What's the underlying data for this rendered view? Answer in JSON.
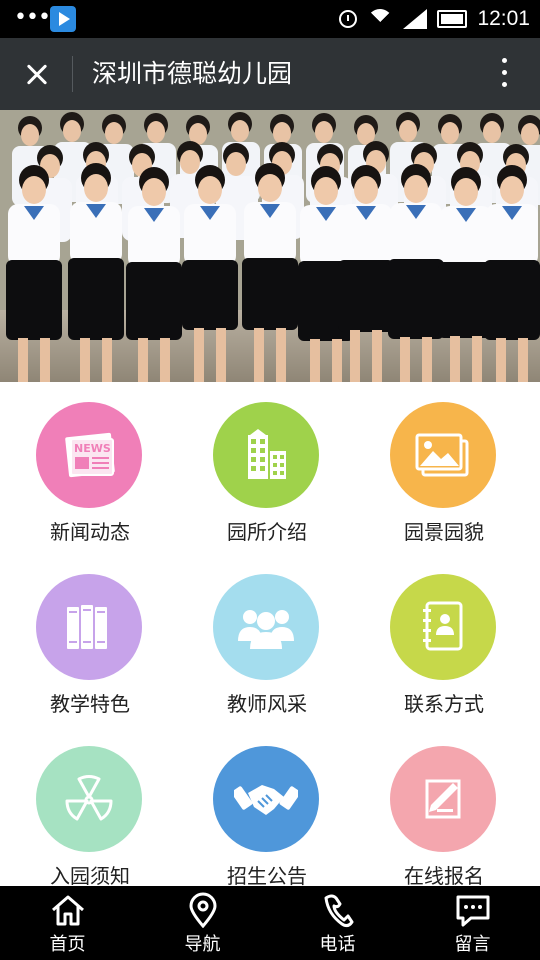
{
  "status_bar": {
    "time": "12:01"
  },
  "title_bar": {
    "title": "深圳市德聪幼儿园"
  },
  "grid": {
    "items": [
      {
        "label": "新闻动态",
        "color": "#f07fb8",
        "icon": "news-icon"
      },
      {
        "label": "园所介绍",
        "color": "#9fd24b",
        "icon": "building-icon"
      },
      {
        "label": "园景园貌",
        "color": "#f7b54b",
        "icon": "gallery-icon"
      },
      {
        "label": "教学特色",
        "color": "#c7a3ea",
        "icon": "books-icon"
      },
      {
        "label": "教师风采",
        "color": "#a4ddee",
        "icon": "people-icon"
      },
      {
        "label": "联系方式",
        "color": "#c6d84a",
        "icon": "contact-book-icon"
      },
      {
        "label": "入园须知",
        "color": "#a6e2c2",
        "icon": "fan-icon"
      },
      {
        "label": "招生公告",
        "color": "#4f97da",
        "icon": "handshake-icon"
      },
      {
        "label": "在线报名",
        "color": "#f4a6ae",
        "icon": "signup-form-icon"
      }
    ]
  },
  "tab_bar": {
    "tabs": [
      {
        "label": "首页",
        "icon": "home-icon"
      },
      {
        "label": "导航",
        "icon": "location-pin-icon"
      },
      {
        "label": "电话",
        "icon": "phone-icon"
      },
      {
        "label": "留言",
        "icon": "message-icon"
      }
    ]
  }
}
